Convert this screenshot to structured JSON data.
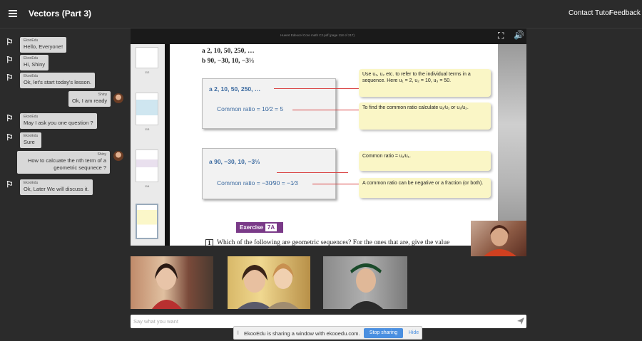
{
  "header": {
    "title": "Vectors (Part 3)",
    "contact_label": "Contact Tutor",
    "feedback_label": "Feedback"
  },
  "chat": [
    {
      "sender": "EkooEdu",
      "text": "Hello, Everyone!",
      "side": "left"
    },
    {
      "sender": "EkooEdu",
      "text": "Hi, Shiny",
      "side": "left"
    },
    {
      "sender": "EkooEdu",
      "text": "Ok, let's start today's lesson.",
      "side": "left"
    },
    {
      "sender": "Shiny",
      "text": "Ok, I am ready",
      "side": "right"
    },
    {
      "sender": "EkooEdu",
      "text": "May I ask you one question ?",
      "side": "left"
    },
    {
      "sender": "EkooEdu",
      "text": "Sure",
      "side": "left"
    },
    {
      "sender": "Shiny",
      "text": "How to calcuate the nth term of a geometric sequnece ?",
      "side": "right"
    },
    {
      "sender": "EkooEdu",
      "text": "Ok, Later We will discuss it.",
      "side": "left"
    }
  ],
  "document": {
    "title": "Hueret Edexcel Core math C2.pdf (page 118 of 217)",
    "thumb_pages": [
      "112",
      "113",
      "114"
    ],
    "line_a": "a  2, 10, 50, 250, …",
    "line_b": "b  90, −30, 10, −3⅓",
    "box1_seq": "a  2, 10, 50, 250, …",
    "box1_ratio": "Common ratio = 10⁄2 = 5",
    "box2_seq": "a  90, −30, 10, −3⅓",
    "box2_ratio": "Common ratio = −30⁄90 = −1⁄3",
    "note1": "Use u₁, u₂ etc. to refer to the individual terms in a sequence. Here u₁ = 2, u₂ = 10, u₃ = 50.",
    "note2": "To find the common ratio calculate u₂⁄u₁ or u₃⁄u₂.",
    "note3": "Common ratio = u₂⁄u₁.",
    "note4": "A common ratio can be negative or a fraction (or both).",
    "exercise_label": "Exercise",
    "exercise_num": "7A",
    "question_num": "1",
    "question_text": "Which of the following are geometric sequences? For the ones that are, give the value"
  },
  "compose": {
    "placeholder": "Say what you want"
  },
  "share": {
    "text": "EkooEdu is sharing a window with ekooedu.com.",
    "stop_label": "Stop sharing",
    "hide_label": "Hide"
  },
  "icons": {
    "menu": "hamburger-icon",
    "bot": "ekooedu-logo-icon",
    "send": "send-icon",
    "fullscreen": "fullscreen-icon",
    "volume": "volume-icon"
  },
  "colors": {
    "background": "#2b2b2b",
    "bubble": "#d8d8d8",
    "accent_blue": "#4a8fe0",
    "exercise_purple": "#7a3a88",
    "note_yellow": "#faf6c6"
  }
}
